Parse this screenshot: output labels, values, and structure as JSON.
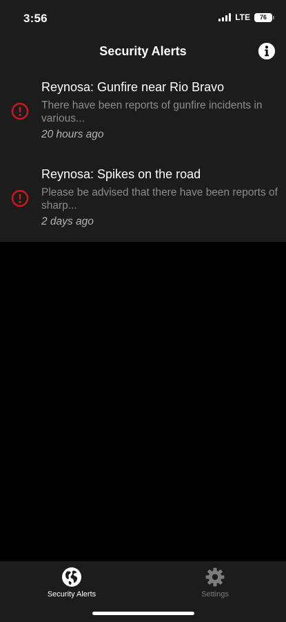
{
  "status_bar": {
    "time": "3:56",
    "network": "LTE",
    "battery": "76"
  },
  "header": {
    "title": "Security Alerts",
    "info_icon": "info-icon"
  },
  "alerts": [
    {
      "title": "Reynosa: Gunfire near Rio Bravo",
      "description": "There have been reports of gunfire incidents in various...",
      "time": "20 hours ago",
      "icon": "alert-circle-icon"
    },
    {
      "title": "Reynosa: Spikes on the road",
      "description": "Please be advised that there have been reports of sharp...",
      "time": "2 days ago",
      "icon": "alert-circle-icon"
    }
  ],
  "tab_bar": {
    "tabs": [
      {
        "label": "Security Alerts",
        "icon": "globe-icon",
        "active": true
      },
      {
        "label": "Settings",
        "icon": "gear-icon",
        "active": false
      }
    ]
  },
  "colors": {
    "background": "#000000",
    "surface": "#1c1c1c",
    "alert_red": "#d0161e",
    "text_secondary": "#8d8d8d",
    "inactive_tab": "#7d7d7d"
  }
}
